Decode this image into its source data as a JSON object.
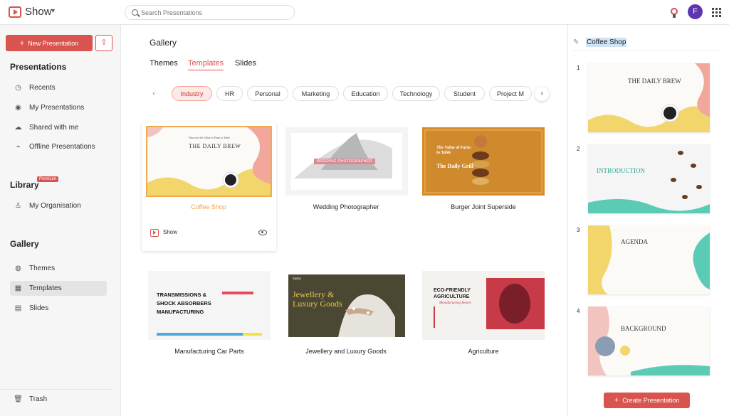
{
  "app": {
    "name": "Show",
    "search_placeholder": "Search Presentations",
    "user_initial": "F",
    "brand_color": "#d9534f"
  },
  "sidebar": {
    "new_label": "New Presentation",
    "presentations_header": "Presentations",
    "presentations": [
      {
        "label": "Recents",
        "icon": "clock-icon"
      },
      {
        "label": "My Presentations",
        "icon": "user-icon"
      },
      {
        "label": "Shared with me",
        "icon": "shared-icon"
      },
      {
        "label": "Offline Presentations",
        "icon": "offline-icon"
      }
    ],
    "library_header": "Library",
    "premium_badge": "Premium",
    "library": [
      {
        "label": "My Organisation",
        "icon": "organisation-icon"
      }
    ],
    "gallery_header": "Gallery",
    "gallery": [
      {
        "label": "Themes",
        "icon": "palette-icon"
      },
      {
        "label": "Templates",
        "icon": "templates-icon"
      },
      {
        "label": "Slides",
        "icon": "slides-icon"
      }
    ],
    "trash_label": "Trash"
  },
  "main": {
    "title": "Gallery",
    "tabs": [
      "Themes",
      "Templates",
      "Slides"
    ],
    "active_tab": "Templates",
    "categories": [
      "Industry",
      "HR",
      "Personal",
      "Marketing",
      "Education",
      "Technology",
      "Student",
      "Project M"
    ],
    "active_category": "Industry",
    "templates": [
      {
        "name": "Coffee Shop",
        "selected": true
      },
      {
        "name": "Wedding Photographer"
      },
      {
        "name": "Burger Joint Superside"
      },
      {
        "name": "Manufacturing Car Parts"
      },
      {
        "name": "Jewellery and Luxury Goods"
      },
      {
        "name": "Agriculture"
      }
    ],
    "hover_show_label": "Show",
    "thumb_text": {
      "coffee_title": "THE DAILY BREW",
      "coffee_small": "Discover the Value of Farm to Table",
      "wedding": "WEDDING PHOTOGRAPHER",
      "burger_a": "The Value of Farm to Table",
      "burger_b": "The Daily Grill",
      "manuf": "TRANSMISSIONS & SHOCK ABSORBERS MANUFACTURING",
      "jewel": "Jewellery & Luxury Goods",
      "jewel_top": "Sasha",
      "agri": "ECO-FRIENDLY AGRICULTURE",
      "agri_sub": "Manufacturing Report"
    }
  },
  "right_panel": {
    "title": "Coffee Shop",
    "slides": [
      {
        "num": "1",
        "title": "THE DAILY BREW"
      },
      {
        "num": "2",
        "title": "INTRODUCTION"
      },
      {
        "num": "3",
        "title": "AGENDA"
      },
      {
        "num": "4",
        "title": "BACKGROUND"
      }
    ],
    "create_label": "Create Presentation"
  }
}
